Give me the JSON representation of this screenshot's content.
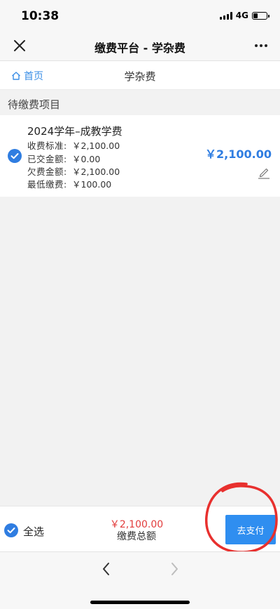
{
  "status_bar": {
    "time": "10:38",
    "network": "4G"
  },
  "nav": {
    "title": "缴费平台 - 学杂费"
  },
  "header": {
    "home_label": "首页",
    "page_title": "学杂费"
  },
  "section": {
    "title": "待缴费项目"
  },
  "item": {
    "title": "2024学年–成教学费",
    "details": [
      {
        "label": "收费标准:",
        "value": "￥2,100.00"
      },
      {
        "label": "已交金额:",
        "value": "￥0.00"
      },
      {
        "label": "欠费金额:",
        "value": "￥2,100.00"
      },
      {
        "label": "最低缴费:",
        "value": "￥100.00"
      }
    ],
    "amount": "￥2,100.00",
    "checked": true
  },
  "footer": {
    "select_all_label": "全选",
    "total_amount": "￥2,100.00",
    "total_label": "缴费总额",
    "pay_label": "去支付"
  },
  "colors": {
    "accent": "#2f7de1",
    "total_red": "#e23c3c",
    "pay_button": "#2f8ef0",
    "annotation_red": "#e8302e"
  },
  "icons": [
    "close-icon",
    "more-icon",
    "home-icon",
    "check-icon",
    "edit-icon",
    "back-arrow-icon",
    "forward-arrow-icon"
  ]
}
